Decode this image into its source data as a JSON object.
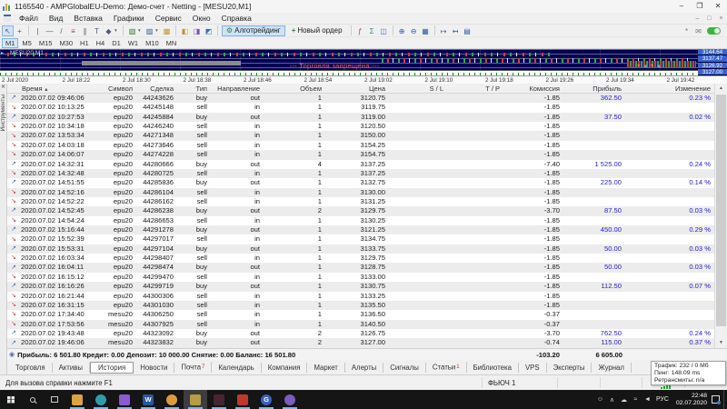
{
  "window": {
    "title": "1165540 - AMPGlobalEU-Demo: Демо-счет - Netting - [MESU20,M1]",
    "controls": {
      "minimize": "–",
      "maximize": "❐",
      "close": "✕"
    }
  },
  "menu": {
    "items": [
      "Файл",
      "Вид",
      "Вставка",
      "Графики",
      "Сервис",
      "Окно",
      "Справка"
    ],
    "child_controls": {
      "minimize": "–",
      "restore": "□",
      "close": "×"
    }
  },
  "toolbar": {
    "algo_trading_label": "Алготрейдинг",
    "new_order_label": "Новый ордер",
    "row1": [
      {
        "n": "cursor-icon",
        "g": "↖",
        "pressed": true
      },
      {
        "n": "crosshair-icon",
        "g": "+"
      },
      {
        "sep": true
      },
      {
        "n": "vertical-line-icon",
        "g": "|"
      },
      {
        "n": "horizontal-line-icon",
        "g": "—"
      },
      {
        "n": "trendline-icon",
        "g": "/"
      },
      {
        "n": "fibonacci-icon",
        "g": "≡",
        "c": "#a33a3a"
      },
      {
        "n": "channel-icon",
        "g": "∥"
      },
      {
        "n": "text-icon",
        "g": "T"
      },
      {
        "n": "shapes-icon",
        "g": "◆",
        "dd": true
      },
      {
        "sep": true
      },
      {
        "n": "new-chart-icon",
        "g": "▧",
        "c": "#2a7a2a",
        "dd": true
      },
      {
        "n": "profiles-icon",
        "g": "▨",
        "c": "#2a5a9a",
        "dd": true
      },
      {
        "n": "templates-folder-icon",
        "g": "▩",
        "c": "#c29136"
      },
      {
        "sep": true
      },
      {
        "n": "market-watch-icon",
        "g": "◧",
        "c": "#c29136"
      },
      {
        "n": "data-window-icon",
        "g": "◨",
        "c": "#7a4fae"
      },
      {
        "n": "navigator-icon",
        "g": "◩",
        "c": "#3a6fae"
      },
      {
        "sep": true
      },
      {
        "button": "algo"
      },
      {
        "button": "order"
      },
      {
        "sep": true
      },
      {
        "n": "indicators-icon",
        "g": "ƒ",
        "c": "#b03a3a"
      },
      {
        "n": "indicator-list-icon",
        "g": "Σ",
        "c": "#2a8a8a"
      },
      {
        "n": "chart-objects-icon",
        "g": "◫",
        "c": "#3a6fae"
      },
      {
        "sep": true
      },
      {
        "n": "zoom-in-icon",
        "g": "⊕",
        "c": "#2a5a9a"
      },
      {
        "n": "zoom-out-icon",
        "g": "⊖",
        "c": "#2a5a9a"
      },
      {
        "n": "tile-windows-icon",
        "g": "▦",
        "c": "#2a5a9a"
      },
      {
        "sep": true
      },
      {
        "n": "auto-scroll-icon",
        "g": "↦",
        "c": "#2a5a9a"
      },
      {
        "n": "chart-shift-icon",
        "g": "↤",
        "c": "#2a5a9a"
      },
      {
        "n": "chart-properties-icon",
        "g": "▤",
        "c": "#2a5a9a"
      }
    ],
    "right_icons": [
      {
        "n": "pin-icon",
        "g": "*"
      },
      {
        "n": "community-chat-icon",
        "g": "✉"
      }
    ],
    "timeframes": [
      "M1",
      "M5",
      "M15",
      "M30",
      "H1",
      "H4",
      "D1",
      "W1",
      "M10",
      "MN"
    ],
    "active_timeframe": "M1"
  },
  "chart": {
    "symbol_label": "MESU20,M1",
    "banner": "--- Торговля запрещена ---",
    "price_labels": [
      "3144.64",
      "3137.47",
      "3126.92",
      "3127.00"
    ],
    "time_axis": [
      "2 Jul 2020",
      "2 Jul 18:22",
      "2 Jul 18:30",
      "2 Jul 18:38",
      "2 Jul 18:46",
      "2 Jul 18:54",
      "2 Jul 19:02",
      "2 Jul 19:10",
      "2 Jul 19:18",
      "2 Jul 19:26",
      "2 Jul 19:34",
      "2 Jul 19:42"
    ]
  },
  "history": {
    "panel_title": "Инструменты",
    "sort_arrow": "▲",
    "columns": [
      "Время",
      "Символ",
      "Сделка",
      "Тип",
      "Направление",
      "Объем",
      "Цена",
      "S / L",
      "T / P",
      "Комиссия",
      "Прибыль",
      "Изменение"
    ],
    "rows": [
      [
        "2020.07.02 09:46:06",
        "epu20",
        "44243626",
        "buy",
        "out",
        "1",
        "3120.75",
        "",
        "",
        "-1.85",
        "362.50",
        "0.23 %"
      ],
      [
        "2020.07.02 10:13:25",
        "epu20",
        "44245148",
        "sell",
        "in",
        "1",
        "3119.75",
        "",
        "",
        "-1.85",
        "",
        ""
      ],
      [
        "2020.07.02 10:27:53",
        "epu20",
        "44245884",
        "buy",
        "out",
        "1",
        "3119.00",
        "",
        "",
        "-1.85",
        "37.50",
        "0.02 %"
      ],
      [
        "2020.07.02 10:34:18",
        "epu20",
        "44246240",
        "sell",
        "in",
        "1",
        "3120.50",
        "",
        "",
        "-1.85",
        "",
        ""
      ],
      [
        "2020.07.02 13:53:34",
        "epu20",
        "44271348",
        "sell",
        "in",
        "1",
        "3150.00",
        "",
        "",
        "-1.85",
        "",
        ""
      ],
      [
        "2020.07.02 14:03:18",
        "epu20",
        "44273646",
        "sell",
        "in",
        "1",
        "3154.25",
        "",
        "",
        "-1.85",
        "",
        ""
      ],
      [
        "2020.07.02 14:06:07",
        "epu20",
        "44274228",
        "sell",
        "in",
        "1",
        "3154.75",
        "",
        "",
        "-1.85",
        "",
        ""
      ],
      [
        "2020.07.02 14:32:31",
        "epu20",
        "44280666",
        "buy",
        "out",
        "4",
        "3137.25",
        "",
        "",
        "-7.40",
        "1 525.00",
        "0.24 %"
      ],
      [
        "2020.07.02 14:32:48",
        "epu20",
        "44280725",
        "sell",
        "in",
        "1",
        "3137.25",
        "",
        "",
        "-1.85",
        "",
        ""
      ],
      [
        "2020.07.02 14:51:55",
        "epu20",
        "44285836",
        "buy",
        "out",
        "1",
        "3132.75",
        "",
        "",
        "-1.85",
        "225.00",
        "0.14 %"
      ],
      [
        "2020.07.02 14:52:16",
        "epu20",
        "44286104",
        "sell",
        "in",
        "1",
        "3130.00",
        "",
        "",
        "-1.85",
        "",
        ""
      ],
      [
        "2020.07.02 14:52:22",
        "epu20",
        "44286162",
        "sell",
        "in",
        "1",
        "3131.25",
        "",
        "",
        "-1.85",
        "",
        ""
      ],
      [
        "2020.07.02 14:52:45",
        "epu20",
        "44286238",
        "buy",
        "out",
        "2",
        "3129.75",
        "",
        "",
        "-3.70",
        "87.50",
        "0.03 %"
      ],
      [
        "2020.07.02 14:54:24",
        "epu20",
        "44286653",
        "sell",
        "in",
        "1",
        "3130.25",
        "",
        "",
        "-1.85",
        "",
        ""
      ],
      [
        "2020.07.02 15:16:44",
        "epu20",
        "44291278",
        "buy",
        "out",
        "1",
        "3121.25",
        "",
        "",
        "-1.85",
        "450.00",
        "0.29 %"
      ],
      [
        "2020.07.02 15:52:39",
        "epu20",
        "44297017",
        "sell",
        "in",
        "1",
        "3134.75",
        "",
        "",
        "-1.85",
        "",
        ""
      ],
      [
        "2020.07.02 15:53:31",
        "epu20",
        "44297104",
        "buy",
        "out",
        "1",
        "3133.75",
        "",
        "",
        "-1.85",
        "50.00",
        "0.03 %"
      ],
      [
        "2020.07.02 16:03:34",
        "epu20",
        "44298407",
        "sell",
        "in",
        "1",
        "3129.75",
        "",
        "",
        "-1.85",
        "",
        ""
      ],
      [
        "2020.07.02 16:04:11",
        "epu20",
        "44298474",
        "buy",
        "out",
        "1",
        "3128.75",
        "",
        "",
        "-1.85",
        "50.00",
        "0.03 %"
      ],
      [
        "2020.07.02 16:15:12",
        "epu20",
        "44299470",
        "sell",
        "in",
        "1",
        "3133.00",
        "",
        "",
        "-1.85",
        "",
        ""
      ],
      [
        "2020.07.02 16:16:26",
        "epu20",
        "44299719",
        "buy",
        "out",
        "1",
        "3130.75",
        "",
        "",
        "-1.85",
        "112.50",
        "0.07 %"
      ],
      [
        "2020.07.02 16:21:44",
        "epu20",
        "44300306",
        "sell",
        "in",
        "1",
        "3133.25",
        "",
        "",
        "-1.85",
        "",
        ""
      ],
      [
        "2020.07.02 16:31:15",
        "epu20",
        "44301030",
        "sell",
        "in",
        "1",
        "3135.50",
        "",
        "",
        "-1.85",
        "",
        ""
      ],
      [
        "2020.07.02 17:34:40",
        "mesu20",
        "44306250",
        "sell",
        "in",
        "1",
        "3136.50",
        "",
        "",
        "-0.37",
        "",
        ""
      ],
      [
        "2020.07.02 17:53:56",
        "mesu20",
        "44307925",
        "sell",
        "in",
        "1",
        "3140.50",
        "",
        "",
        "-0.37",
        "",
        ""
      ],
      [
        "2020.07.02 19:43:48",
        "epu20",
        "44323092",
        "buy",
        "out",
        "2",
        "3126.75",
        "",
        "",
        "-3.70",
        "762.50",
        "0.24 %"
      ],
      [
        "2020.07.02 19:46:06",
        "mesu20",
        "44323832",
        "buy",
        "out",
        "2",
        "3127.00",
        "",
        "",
        "-0.74",
        "115.00",
        "0.37 %"
      ]
    ],
    "summary": {
      "text": "Прибыль: 6 501.80  Кредит: 0.00  Депозит: 10 000.00  Снятие: 0.00  Баланс: 16 501.80",
      "commission_total": "-103.20",
      "profit_total": "6 605.00"
    },
    "tabs": [
      {
        "label": "Торговля"
      },
      {
        "label": "Активы"
      },
      {
        "label": "История",
        "active": true
      },
      {
        "label": "Новости"
      },
      {
        "label": "Почта",
        "badge": "7"
      },
      {
        "label": "Календарь"
      },
      {
        "label": "Компания"
      },
      {
        "label": "Маркет"
      },
      {
        "label": "Алерты"
      },
      {
        "label": "Сигналы"
      },
      {
        "label": "Статьи",
        "badge": "1"
      },
      {
        "label": "Библиотека"
      },
      {
        "label": "VPS"
      },
      {
        "label": "Эксперты"
      },
      {
        "label": "Журнал"
      }
    ]
  },
  "statusbar": {
    "help_text": "Для вызова справки нажмите F1",
    "account_mode": "ФЬЮЧ 1",
    "tooltip": {
      "line1": "Трафик: 232 / 0 Мб",
      "line2": "Пинг: 148.09 ms",
      "line3": "Ретрансмиты: n/a"
    }
  },
  "taskbar": {
    "lang": "РУС",
    "time": "22:48",
    "date": "02.07.2020",
    "apps": [
      {
        "name": "explorer-icon",
        "color": "#d9a441",
        "running": true
      },
      {
        "name": "edge-icon",
        "color": "#2f9ca8",
        "round": true,
        "running": true
      },
      {
        "name": "pen-app-icon",
        "color": "#8a5ad1",
        "running": true
      },
      {
        "name": "word-icon",
        "color": "#2b579a",
        "letter": "W",
        "running": true
      },
      {
        "name": "orange-app-icon",
        "color": "#de9b3c",
        "round": true,
        "running": true
      },
      {
        "name": "metatrader-icon",
        "color": "#b99b45",
        "running": true,
        "active": true
      },
      {
        "name": "dark-app-icon",
        "color": "#4a2530",
        "running": true
      },
      {
        "name": "red-app-icon",
        "color": "#c0392b",
        "running": true
      },
      {
        "name": "g-app-icon",
        "color": "#3b5fc0",
        "letter": "G",
        "round": true,
        "running": true
      },
      {
        "name": "viber-icon",
        "color": "#7d5bbe",
        "round": true,
        "running": true
      }
    ],
    "tray": [
      {
        "n": "people-icon",
        "g": "☺"
      },
      {
        "n": "hidden-icons-chevron",
        "g": "∧"
      },
      {
        "n": "onedrive-cloud-icon",
        "g": "☁"
      },
      {
        "n": "network-icon",
        "g": "≈"
      },
      {
        "n": "volume-icon",
        "g": "◄"
      }
    ]
  },
  "colors": {
    "profit_blue": "#2222cc",
    "sell_red": "#d03a2f",
    "buy_blue": "#2f6fd0",
    "chart_bg": "#000051",
    "price_box": "#3a63cf"
  }
}
